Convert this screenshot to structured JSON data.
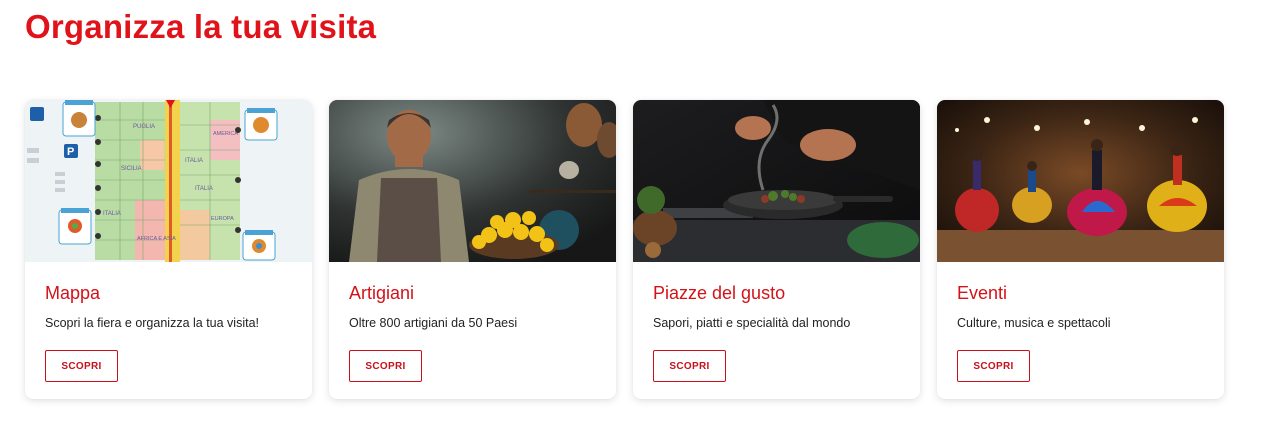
{
  "section": {
    "title": "Organizza la tua visita"
  },
  "cards": [
    {
      "title": "Mappa",
      "description": "Scopri la fiera e organizza la tua visita!",
      "button": "SCOPRI",
      "image": "map-image",
      "map_labels": [
        "PARCHEGGIO",
        "P",
        "P",
        "PIAZZA DEL GUSTO",
        "PIAZZA DEL GUSTO",
        "PIAZZA DEL GUSTO",
        "PIAZZA DEL GUSTO",
        "PUGLIA",
        "SICILIA",
        "ITALIA",
        "ITALIA",
        "ITALIA",
        "AFRICA E ASIA",
        "EUROPA",
        "AMERICA"
      ]
    },
    {
      "title": "Artigiani",
      "description": "Oltre 800 artigiani da 50 Paesi",
      "button": "SCOPRI",
      "image": "artisan-photo"
    },
    {
      "title": "Piazze del gusto",
      "description": "Sapori, piatti e specialità dal mondo",
      "button": "SCOPRI",
      "image": "chef-photo"
    },
    {
      "title": "Eventi",
      "description": "Culture, musica e spettacoli",
      "button": "SCOPRI",
      "image": "dancers-photo"
    }
  ],
  "colors": {
    "accent": "#e0131a",
    "button_border": "#c8101a"
  }
}
